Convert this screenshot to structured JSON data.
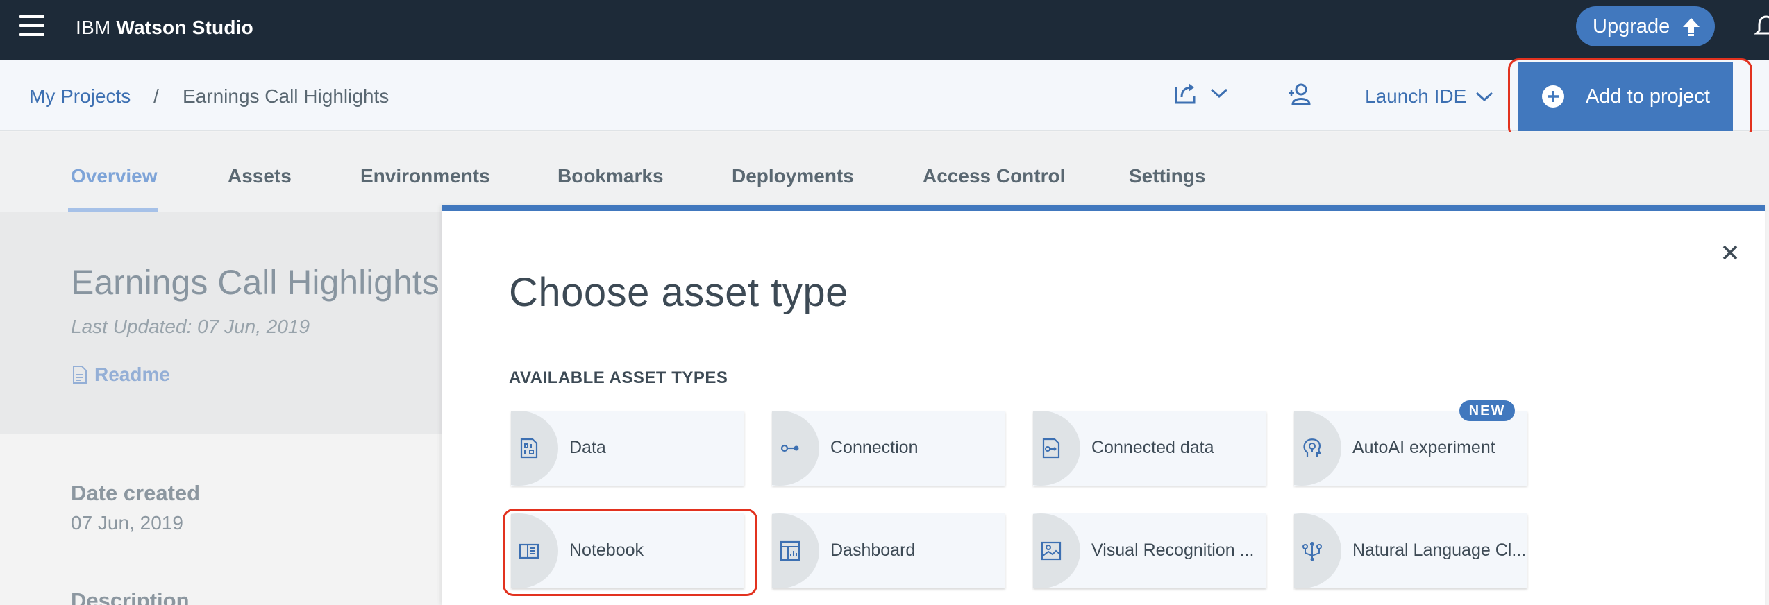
{
  "header": {
    "brand_prefix": "IBM",
    "brand_name": "Watson Studio",
    "upgrade_label": "Upgrade"
  },
  "breadcrumb": {
    "parent": "My Projects",
    "separator": "/",
    "current": "Earnings Call Highlights"
  },
  "toolbar": {
    "launch_ide_label": "Launch IDE",
    "add_to_project_label": "Add to project"
  },
  "tabs": [
    {
      "label": "Overview",
      "active": true
    },
    {
      "label": "Assets"
    },
    {
      "label": "Environments"
    },
    {
      "label": "Bookmarks"
    },
    {
      "label": "Deployments"
    },
    {
      "label": "Access Control"
    },
    {
      "label": "Settings"
    }
  ],
  "project": {
    "title": "Earnings Call Highlights",
    "last_updated": "Last Updated:  07 Jun, 2019",
    "readme_label": "Readme",
    "date_created_label": "Date created",
    "date_created_value": "07 Jun, 2019",
    "description_label": "Description"
  },
  "modal": {
    "title": "Choose asset type",
    "section_label": "AVAILABLE ASSET TYPES",
    "new_badge": "NEW",
    "assets": [
      {
        "label": "Data",
        "icon": "data-icon"
      },
      {
        "label": "Connection",
        "icon": "connection-icon"
      },
      {
        "label": "Connected data",
        "icon": "connected-data-icon"
      },
      {
        "label": "AutoAI experiment",
        "icon": "autoai-icon"
      },
      {
        "label": "Notebook",
        "icon": "notebook-icon"
      },
      {
        "label": "Dashboard",
        "icon": "dashboard-icon"
      },
      {
        "label": "Visual Recognition ...",
        "icon": "visual-recognition-icon"
      },
      {
        "label": "Natural Language Cl...",
        "icon": "natural-language-icon"
      }
    ]
  },
  "colors": {
    "header_bg": "#1d2a38",
    "accent": "#4178be",
    "highlight": "#e2321f"
  }
}
